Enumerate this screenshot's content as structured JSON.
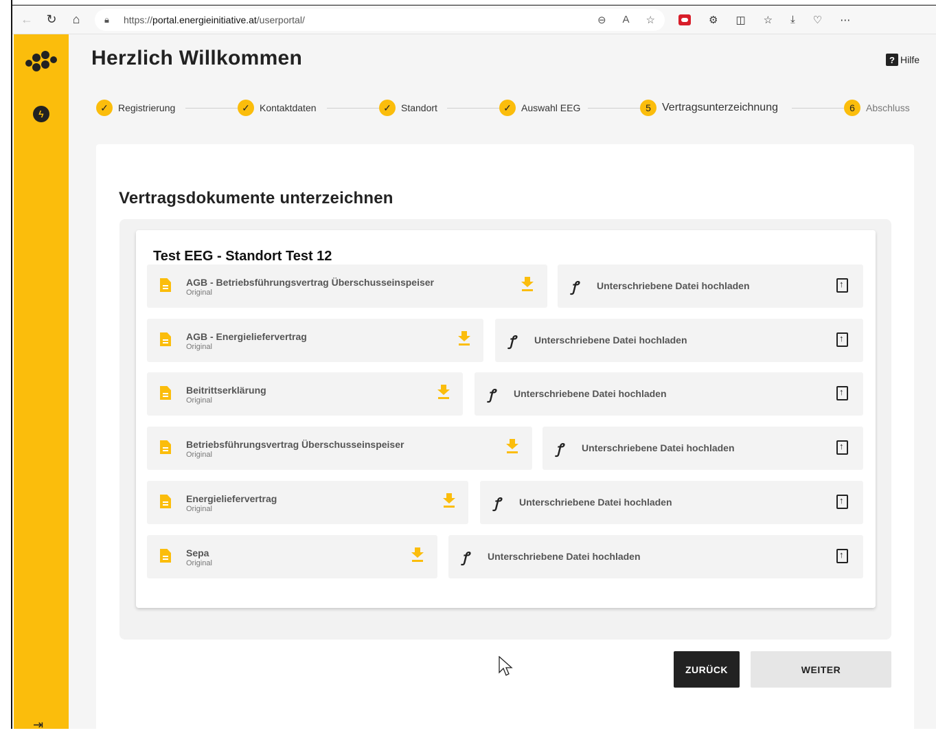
{
  "browser": {
    "url_prefix": "https://",
    "url_host": "portal.energieinitiative.at",
    "url_path": "/userportal/"
  },
  "header": {
    "title": "Herzlich Willkommen",
    "help_label": "Hilfe"
  },
  "stepper": {
    "steps": [
      {
        "label": "Registrierung",
        "marker": "✓",
        "state": "done"
      },
      {
        "label": "Kontaktdaten",
        "marker": "✓",
        "state": "done"
      },
      {
        "label": "Standort",
        "marker": "✓",
        "state": "done"
      },
      {
        "label": "Auswahl EEG",
        "marker": "✓",
        "state": "done"
      },
      {
        "label": "Vertragsunterzeichnung",
        "marker": "5",
        "state": "active"
      },
      {
        "label": "Abschluss",
        "marker": "6",
        "state": "pending"
      }
    ]
  },
  "section": {
    "title": "Vertragsdokumente unterzeichnen",
    "location_title": "Test EEG - Standort Test 12"
  },
  "documents": [
    {
      "name": "AGB - Betriebsführungsvertrag Überschusseinspeiser",
      "sub": "Original",
      "upload_label": "Unterschriebene Datei hochladen"
    },
    {
      "name": "AGB - Energieliefervertrag",
      "sub": "Original",
      "upload_label": "Unterschriebene Datei hochladen"
    },
    {
      "name": "Beitrittserklärung",
      "sub": "Original",
      "upload_label": "Unterschriebene Datei hochladen"
    },
    {
      "name": "Betriebsführungsvertrag Überschusseinspeiser",
      "sub": "Original",
      "upload_label": "Unterschriebene Datei hochladen"
    },
    {
      "name": "Energieliefervertrag",
      "sub": "Original",
      "upload_label": "Unterschriebene Datei hochladen"
    },
    {
      "name": "Sepa",
      "sub": "Original",
      "upload_label": "Unterschriebene Datei hochladen"
    }
  ],
  "actions": {
    "back_label": "ZURÜCK",
    "next_label": "WEITER"
  },
  "colors": {
    "accent": "#fbbd0c",
    "dark": "#222222"
  }
}
